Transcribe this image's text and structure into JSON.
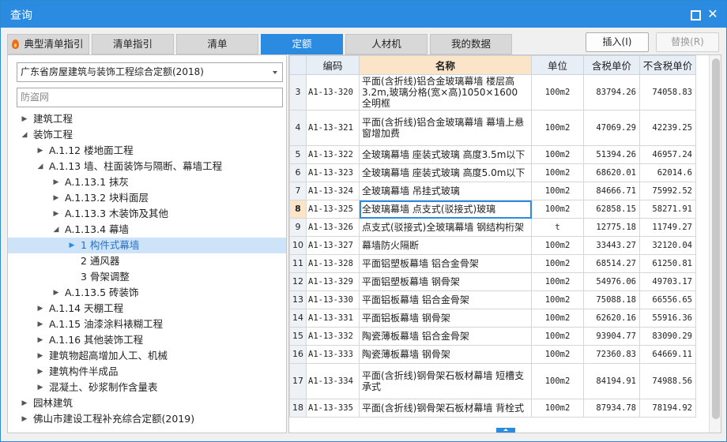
{
  "window": {
    "title": "查询"
  },
  "tabs": [
    "典型清单指引",
    "清单指引",
    "清单",
    "定额",
    "人材机",
    "我的数据"
  ],
  "buttons": {
    "insert": "插入(I)",
    "replace": "替换(R)"
  },
  "left": {
    "selected_library": "广东省房屋建筑与装饰工程综合定额(2018)",
    "search_value": "防盗网",
    "tree": [
      {
        "label": "建筑工程",
        "level": 0,
        "expander": "▶"
      },
      {
        "label": "装饰工程",
        "level": 0,
        "expander": "◢"
      },
      {
        "label": "A.1.12 楼地面工程",
        "level": 1,
        "expander": "▶"
      },
      {
        "label": "A.1.13 墙、柱面装饰与隔断、幕墙工程",
        "level": 1,
        "expander": "◢"
      },
      {
        "label": "A.1.13.1 抹灰",
        "level": 2,
        "expander": "▶"
      },
      {
        "label": "A.1.13.2 块料面层",
        "level": 2,
        "expander": "▶"
      },
      {
        "label": "A.1.13.3 木装饰及其他",
        "level": 2,
        "expander": "▶"
      },
      {
        "label": "A.1.13.4 幕墙",
        "level": 2,
        "expander": "◢"
      },
      {
        "label": "1 构件式幕墙",
        "level": 3,
        "expander": "▶",
        "selected": true
      },
      {
        "label": "2 通风器",
        "level": 3,
        "expander": ""
      },
      {
        "label": "3 骨架调整",
        "level": 3,
        "expander": ""
      },
      {
        "label": "A.1.13.5 砖装饰",
        "level": 2,
        "expander": "▶"
      },
      {
        "label": "A.1.14 天棚工程",
        "level": 1,
        "expander": "▶"
      },
      {
        "label": "A.1.15 油漆涂料裱糊工程",
        "level": 1,
        "expander": "▶"
      },
      {
        "label": "A.1.16 其他装饰工程",
        "level": 1,
        "expander": "▶"
      },
      {
        "label": "建筑物超高增加人工、机械",
        "level": 1,
        "expander": "▶"
      },
      {
        "label": "建筑构件半成品",
        "level": 1,
        "expander": "▶"
      },
      {
        "label": "混凝土、砂浆制作含量表",
        "level": 1,
        "expander": "▶"
      },
      {
        "label": "园林建筑",
        "level": 0,
        "expander": "▶"
      },
      {
        "label": "佛山市建设工程补充综合定额(2019)",
        "level": 0,
        "expander": "▶"
      }
    ]
  },
  "table": {
    "headers": [
      "",
      "编码",
      "名称",
      "单位",
      "含税单价",
      "不含税单价"
    ],
    "rows": [
      {
        "n": "3",
        "code": "A1-13-320",
        "name": "平面(含折线)铝合金玻璃幕墙 楼层高3.2m,玻璃分格(宽×高)1050×1600 全明框",
        "unit": "100m2",
        "tax": "83794.26",
        "notax": "74058.83",
        "tall": true
      },
      {
        "n": "4",
        "code": "A1-13-321",
        "name": "平面(含折线)铝合金玻璃幕墙 幕墙上悬窗增加费",
        "unit": "100m2",
        "tax": "47069.29",
        "notax": "42239.25",
        "tall": true
      },
      {
        "n": "5",
        "code": "A1-13-322",
        "name": "全玻璃幕墙 座装式玻璃 高度3.5m以下",
        "unit": "100m2",
        "tax": "51394.26",
        "notax": "46957.24"
      },
      {
        "n": "6",
        "code": "A1-13-323",
        "name": "全玻璃幕墙 座装式玻璃 高度5.0m以下",
        "unit": "100m2",
        "tax": "68620.01",
        "notax": "62014.6"
      },
      {
        "n": "7",
        "code": "A1-13-324",
        "name": "全玻璃幕墙 吊挂式玻璃",
        "unit": "100m2",
        "tax": "84666.71",
        "notax": "75992.52"
      },
      {
        "n": "8",
        "code": "A1-13-325",
        "name": "全玻璃幕墙 点支式(驳接式)玻璃",
        "unit": "100m2",
        "tax": "62858.15",
        "notax": "58271.91",
        "current": true
      },
      {
        "n": "9",
        "code": "A1-13-326",
        "name": "点支式(驳接式)全玻璃幕墙 钢结构桁架",
        "unit": "t",
        "tax": "12775.18",
        "notax": "11749.27"
      },
      {
        "n": "10",
        "code": "A1-13-327",
        "name": "幕墙防火隔断",
        "unit": "100m2",
        "tax": "33443.27",
        "notax": "32120.04"
      },
      {
        "n": "11",
        "code": "A1-13-328",
        "name": "平面铝塑板幕墙 铝合金骨架",
        "unit": "100m2",
        "tax": "68514.27",
        "notax": "61250.81"
      },
      {
        "n": "12",
        "code": "A1-13-329",
        "name": "平面铝塑板幕墙 钢骨架",
        "unit": "100m2",
        "tax": "54976.06",
        "notax": "49703.17"
      },
      {
        "n": "13",
        "code": "A1-13-330",
        "name": "平面铝板幕墙 铝合金骨架",
        "unit": "100m2",
        "tax": "75088.18",
        "notax": "66556.65"
      },
      {
        "n": "14",
        "code": "A1-13-331",
        "name": "平面铝板幕墙 钢骨架",
        "unit": "100m2",
        "tax": "62620.16",
        "notax": "55916.36"
      },
      {
        "n": "15",
        "code": "A1-13-332",
        "name": "陶瓷薄板幕墙 铝合金骨架",
        "unit": "100m2",
        "tax": "93904.77",
        "notax": "83090.29"
      },
      {
        "n": "16",
        "code": "A1-13-333",
        "name": "陶瓷薄板幕墙 钢骨架",
        "unit": "100m2",
        "tax": "72360.83",
        "notax": "64669.11"
      },
      {
        "n": "17",
        "code": "A1-13-334",
        "name": "平面(含折线)钢骨架石板材幕墙 短槽支承式",
        "unit": "100m2",
        "tax": "84194.91",
        "notax": "74988.56",
        "tall": true
      },
      {
        "n": "18",
        "code": "A1-13-335",
        "name": "平面(含折线)钢骨架石板材幕墙 背栓式",
        "unit": "100m2",
        "tax": "87934.78",
        "notax": "78194.92"
      }
    ]
  }
}
